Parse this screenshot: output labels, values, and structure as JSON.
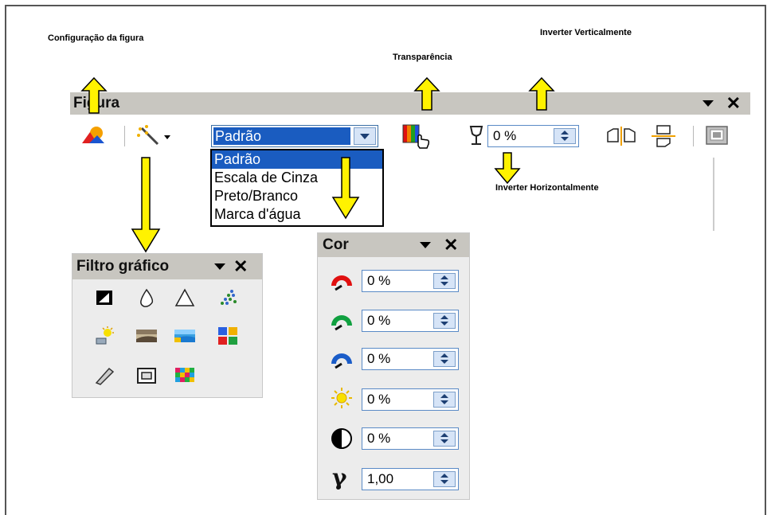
{
  "annotations": {
    "config": "Configuração  da figura",
    "transparency": "Transparência",
    "invert_v": "Inverter Verticalmente",
    "invert_h": "Inverter Horizontalmente"
  },
  "toolbar": {
    "title": "Figura",
    "mode_value": "Padrão",
    "mode_options": [
      "Padrão",
      "Escala de Cinza",
      "Preto/Branco",
      "Marca d'água"
    ],
    "transparency_value": "0 %"
  },
  "filter_panel": {
    "title": "Filtro gráfico"
  },
  "color_panel": {
    "title": "Cor",
    "rows": [
      {
        "name": "red",
        "value": "0 %"
      },
      {
        "name": "green",
        "value": "0 %"
      },
      {
        "name": "blue",
        "value": "0 %"
      },
      {
        "name": "brightness",
        "value": "0 %"
      },
      {
        "name": "contrast",
        "value": "0 %"
      },
      {
        "name": "gamma",
        "value": "1,00"
      }
    ]
  },
  "colors": {
    "arrow_fill": "#fff200",
    "selection": "#1a5cc0",
    "titlebar": "#c8c6c0"
  }
}
